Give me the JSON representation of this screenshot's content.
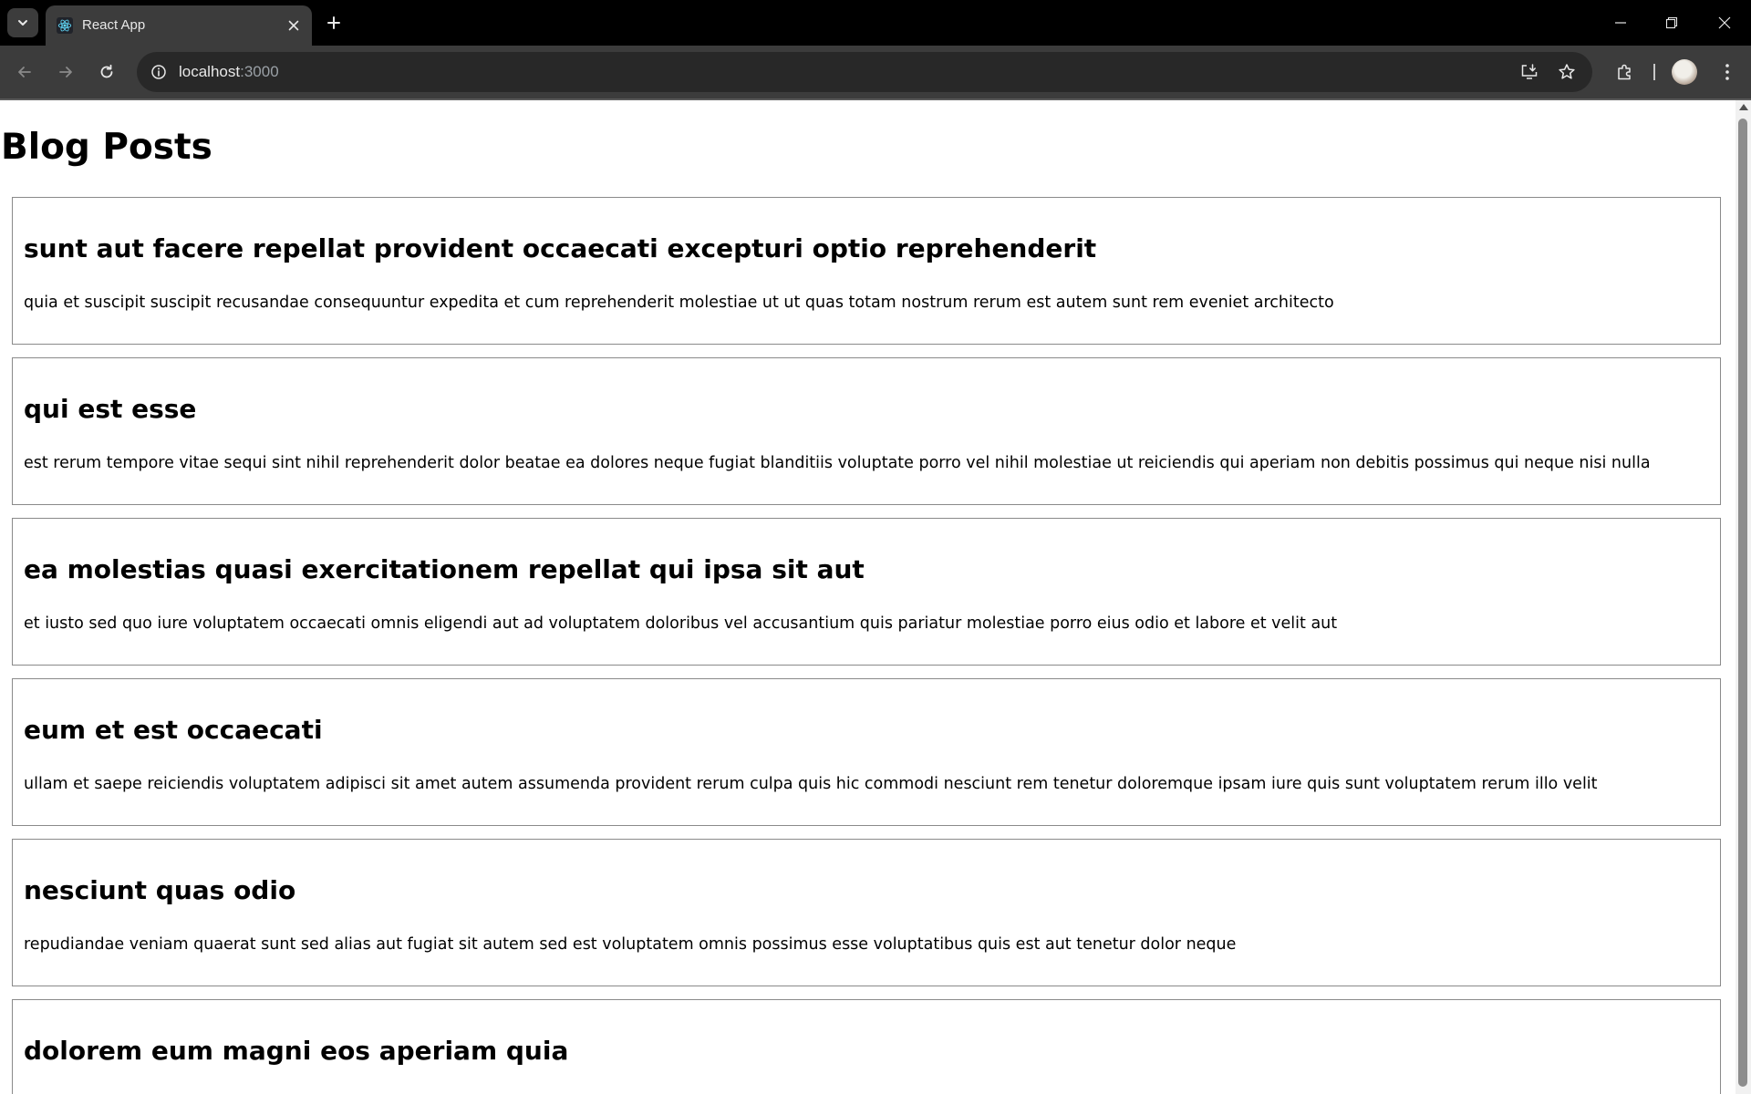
{
  "browser": {
    "tab": {
      "title": "React App"
    },
    "url": {
      "host": "localhost",
      "port": ":3000"
    },
    "icons": {
      "tab_search": "chevron-down-icon",
      "favicon": "react-logo-icon",
      "tab_close": "close-icon",
      "new_tab": "plus-icon",
      "minimize": "minimize-icon",
      "restore": "restore-icon",
      "close_window": "close-icon",
      "back": "arrow-left-icon",
      "forward": "arrow-right-icon",
      "reload": "reload-icon",
      "site_info": "info-icon",
      "install_app": "install-icon",
      "bookmark": "star-icon",
      "extensions": "puzzle-icon",
      "profile": "avatar",
      "menu": "kebab-menu-icon"
    },
    "colors": {
      "tabstrip": "#000000",
      "toolbar": "#3c3c3c",
      "omnibox": "#282828"
    }
  },
  "page": {
    "title": "Blog Posts",
    "posts": [
      {
        "title": "sunt aut facere repellat provident occaecati excepturi optio reprehenderit",
        "body": "quia et suscipit suscipit recusandae consequuntur expedita et cum reprehenderit molestiae ut ut quas totam nostrum rerum est autem sunt rem eveniet architecto"
      },
      {
        "title": "qui est esse",
        "body": "est rerum tempore vitae sequi sint nihil reprehenderit dolor beatae ea dolores neque fugiat blanditiis voluptate porro vel nihil molestiae ut reiciendis qui aperiam non debitis possimus qui neque nisi nulla"
      },
      {
        "title": "ea molestias quasi exercitationem repellat qui ipsa sit aut",
        "body": "et iusto sed quo iure voluptatem occaecati omnis eligendi aut ad voluptatem doloribus vel accusantium quis pariatur molestiae porro eius odio et labore et velit aut"
      },
      {
        "title": "eum et est occaecati",
        "body": "ullam et saepe reiciendis voluptatem adipisci sit amet autem assumenda provident rerum culpa quis hic commodi nesciunt rem tenetur doloremque ipsam iure quis sunt voluptatem rerum illo velit"
      },
      {
        "title": "nesciunt quas odio",
        "body": "repudiandae veniam quaerat sunt sed alias aut fugiat sit autem sed est voluptatem omnis possimus esse voluptatibus quis est aut tenetur dolor neque"
      },
      {
        "title": "dolorem eum magni eos aperiam quia",
        "body": ""
      }
    ]
  }
}
